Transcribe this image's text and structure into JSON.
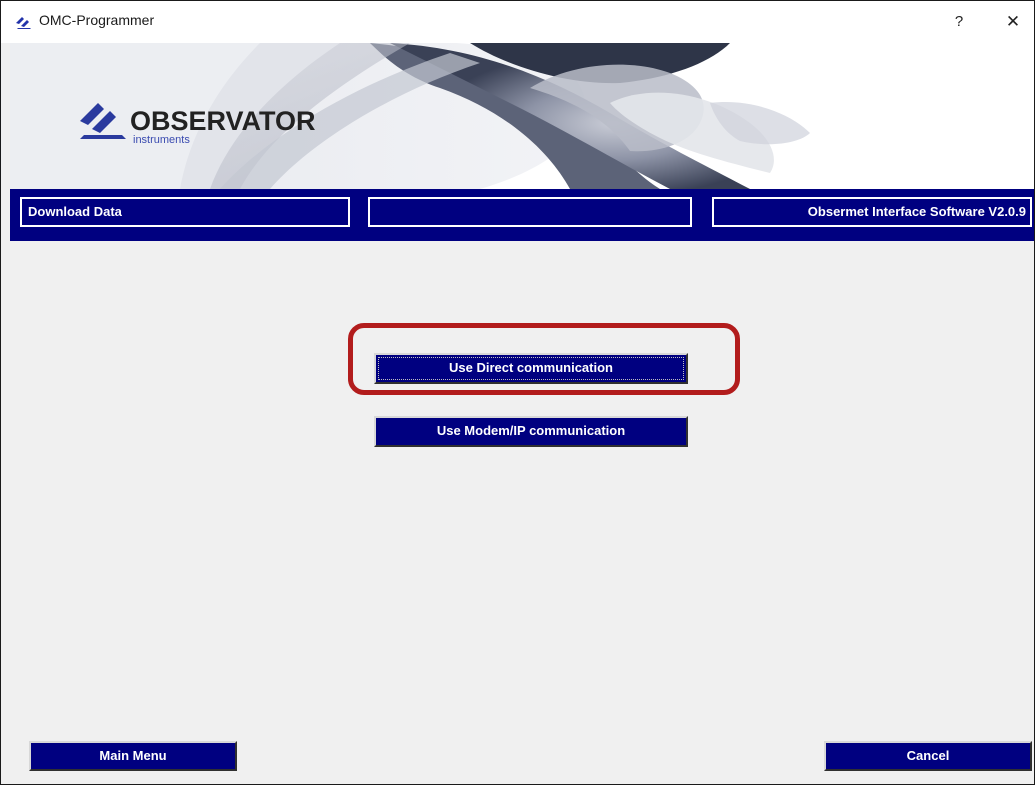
{
  "window": {
    "title": "OMC-Programmer",
    "help_label": "?",
    "close_label": "✕"
  },
  "banner": {
    "logo_text": "OBSERVATOR",
    "logo_subtext": "instruments"
  },
  "navbar": {
    "left_label": "Download Data",
    "middle_label": "",
    "right_label": "Obsermet Interface Software V2.0.9"
  },
  "main": {
    "direct_button_label": "Use Direct communication",
    "modem_button_label": "Use Modem/IP communication"
  },
  "footer": {
    "main_menu_label": "Main Menu",
    "cancel_label": "Cancel"
  },
  "colors": {
    "accent_navy": "#000080",
    "highlight_red": "#b21c1c"
  }
}
